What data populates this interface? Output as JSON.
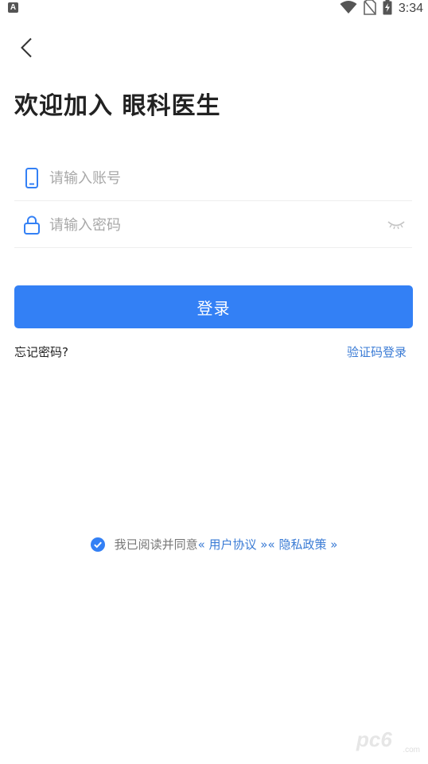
{
  "status_bar": {
    "app_indicator": "A",
    "time": "3:34",
    "icons": [
      "wifi-icon",
      "no-sim-icon",
      "battery-charging-icon"
    ]
  },
  "header": {
    "back_icon": "chevron-left-icon",
    "title": "欢迎加入 眼科医生"
  },
  "form": {
    "account": {
      "icon": "phone-icon",
      "placeholder": "请输入账号",
      "value": ""
    },
    "password": {
      "icon": "lock-icon",
      "placeholder": "请输入密码",
      "value": "",
      "toggle_icon": "eye-closed-icon"
    },
    "login_label": "登录",
    "forgot_label": "忘记密码?",
    "code_login_label": "验证码登录"
  },
  "agreement": {
    "checked": true,
    "text": "我已阅读并同意",
    "user_agreement": "« 用户协议 »",
    "privacy_policy": "« 隐私政策 »"
  },
  "watermark": {
    "text": "pc6",
    "sub": ".com"
  },
  "colors": {
    "accent": "#3380f5",
    "link": "#3a7bd5",
    "placeholder": "#a8a8a8",
    "divider": "#eeeeee"
  }
}
